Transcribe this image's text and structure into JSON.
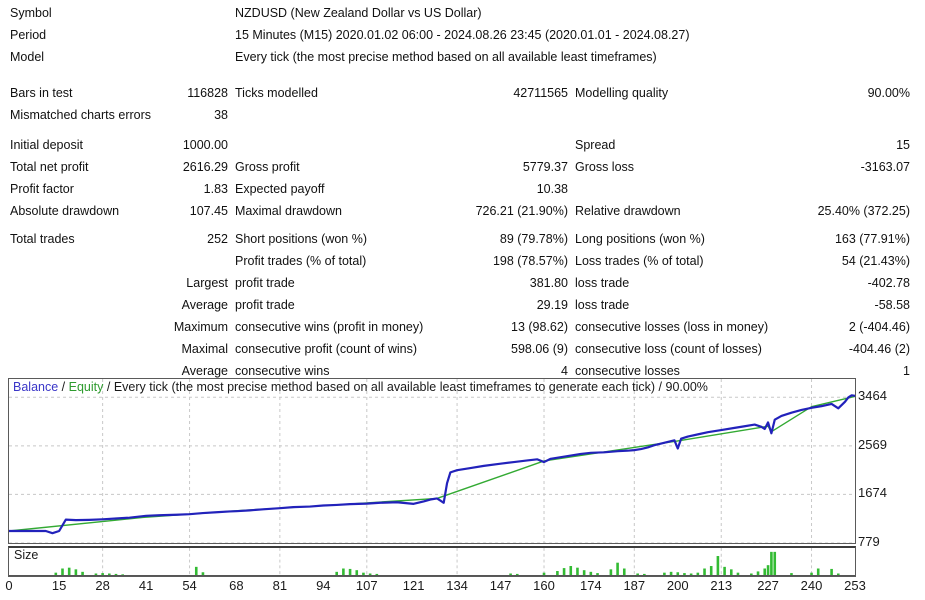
{
  "header": {
    "rows": [
      {
        "label": "Symbol",
        "value": "NZDUSD (New Zealand Dollar vs US Dollar)"
      },
      {
        "label": "Period",
        "value": "15 Minutes (M15) 2020.01.02 06:00 - 2024.08.26 23:45 (2020.01.01 - 2024.08.27)"
      },
      {
        "label": "Model",
        "value": "Every tick (the most precise method based on all available least timeframes)"
      }
    ]
  },
  "stats": {
    "groups": [
      {
        "rows": [
          {
            "c1_label": "Bars in test",
            "c1_value": "116828",
            "c2_label": "Ticks modelled",
            "c2_value": "42711565",
            "c3_label": "Modelling quality",
            "c3_value": "90.00%"
          },
          {
            "c1_label": "Mismatched charts errors",
            "c1_value": "38",
            "c2_label": "",
            "c2_value": "",
            "c3_label": "",
            "c3_value": ""
          }
        ]
      },
      {
        "rows": [
          {
            "c1_label": "Initial deposit",
            "c1_value": "1000.00",
            "c2_label": "",
            "c2_value": "",
            "c3_label": "Spread",
            "c3_value": "15"
          },
          {
            "c1_label": "Total net profit",
            "c1_value": "2616.29",
            "c2_label": "Gross profit",
            "c2_value": "5779.37",
            "c3_label": "Gross loss",
            "c3_value": "-3163.07"
          },
          {
            "c1_label": "Profit factor",
            "c1_value": "1.83",
            "c2_label": "Expected payoff",
            "c2_value": "10.38",
            "c3_label": "",
            "c3_value": ""
          },
          {
            "c1_label": "Absolute drawdown",
            "c1_value": "107.45",
            "c2_label": "Maximal drawdown",
            "c2_value": "726.21 (21.90%)",
            "c3_label": "Relative drawdown",
            "c3_value": "25.40% (372.25)"
          }
        ]
      },
      {
        "rows": [
          {
            "c1_label": "Total trades",
            "c1_value": "252",
            "c2_label": "Short positions (won %)",
            "c2_value": "89 (79.78%)",
            "c3_label": "Long positions (won %)",
            "c3_value": "163 (77.91%)"
          },
          {
            "c1_label": "",
            "c1_value": "",
            "c2_label": "Profit trades (% of total)",
            "c2_value": "198 (78.57%)",
            "c3_label": "Loss trades (% of total)",
            "c3_value": "54 (21.43%)"
          },
          {
            "c1_prefix": "Largest",
            "c2_label": "profit trade",
            "c2_value": "381.80",
            "c3_label": "loss trade",
            "c3_value": "-402.78"
          },
          {
            "c1_prefix": "Average",
            "c2_label": "profit trade",
            "c2_value": "29.19",
            "c3_label": "loss trade",
            "c3_value": "-58.58"
          },
          {
            "c1_prefix": "Maximum",
            "c2_label": "consecutive wins (profit in money)",
            "c2_value": "13 (98.62)",
            "c3_label": "consecutive losses (loss in money)",
            "c3_value": "2 (-404.46)"
          },
          {
            "c1_prefix": "Maximal",
            "c2_label": "consecutive profit (count of wins)",
            "c2_value": "598.06 (9)",
            "c3_label": "consecutive loss (count of losses)",
            "c3_value": "-404.46 (2)"
          },
          {
            "c1_prefix": "Average",
            "c2_label": "consecutive wins",
            "c2_value": "4",
            "c3_label": "consecutive losses",
            "c3_value": "1"
          }
        ]
      }
    ]
  },
  "chart": {
    "legend": {
      "balance": "Balance",
      "equity": "Equity",
      "separator": "/",
      "description": "Every tick (the most precise method based on all available least timeframes to generate each tick) / 90.00%"
    },
    "size_panel_label": "Size",
    "colors": {
      "balance_line": "#2222bb",
      "equity_line": "#33aa33",
      "size_bar": "#33bb33",
      "grid": "#c8c8c8",
      "border": "#5a5a5a"
    }
  },
  "chart_data": {
    "type": "line",
    "title": "Balance / Equity / Every tick (the most precise method based on all available least timeframes to generate each tick) / 90.00%",
    "xlabel": "",
    "ylabel": "",
    "grid": true,
    "legend_position": "top-left",
    "xlim": [
      0,
      253
    ],
    "ylim": [
      779,
      3800
    ],
    "yticks": [
      779,
      1674,
      2569,
      3464
    ],
    "xticks": [
      0,
      15,
      28,
      41,
      54,
      68,
      81,
      94,
      107,
      121,
      134,
      147,
      160,
      174,
      187,
      200,
      213,
      227,
      240,
      253
    ],
    "series": [
      {
        "name": "Balance",
        "color": "#2222bb",
        "x": [
          0,
          4,
          8,
          11,
          13,
          15,
          17,
          20,
          24,
          28,
          32,
          36,
          41,
          45,
          50,
          54,
          58,
          62,
          66,
          68,
          72,
          76,
          81,
          85,
          90,
          94,
          98,
          102,
          107,
          111,
          116,
          121,
          124,
          126,
          128,
          129,
          130,
          131,
          132,
          134,
          138,
          142,
          147,
          151,
          155,
          158,
          160,
          162,
          165,
          168,
          171,
          174,
          178,
          182,
          185,
          187,
          189,
          191,
          193,
          195,
          197,
          199,
          200,
          201,
          203,
          206,
          209,
          213,
          217,
          220,
          223,
          225,
          226,
          227,
          228,
          229,
          231,
          234,
          237,
          240,
          243,
          246,
          248,
          250,
          251,
          252,
          253
        ],
        "y": [
          1000,
          1000,
          1000,
          1000,
          960,
          1000,
          1210,
          1200,
          1205,
          1215,
          1230,
          1245,
          1280,
          1290,
          1300,
          1310,
          1330,
          1345,
          1360,
          1365,
          1380,
          1400,
          1420,
          1440,
          1450,
          1470,
          1480,
          1495,
          1505,
          1520,
          1530,
          1500,
          1545,
          1580,
          1600,
          1560,
          1520,
          1880,
          2080,
          2120,
          2160,
          2200,
          2240,
          2270,
          2300,
          2320,
          2270,
          2330,
          2360,
          2390,
          2420,
          2440,
          2450,
          2470,
          2480,
          2490,
          2510,
          2540,
          2580,
          2610,
          2640,
          2670,
          2520,
          2700,
          2740,
          2780,
          2820,
          2860,
          2900,
          2930,
          2960,
          2920,
          2880,
          3000,
          2800,
          3050,
          3120,
          3180,
          3230,
          3270,
          3300,
          3340,
          3260,
          3380,
          3460,
          3500,
          3490
        ]
      },
      {
        "name": "Equity",
        "color": "#33aa33",
        "x": [
          0,
          40,
          70,
          100,
          128,
          160,
          200,
          227,
          228,
          240,
          253
        ],
        "y": [
          1000,
          1250,
          1380,
          1490,
          1600,
          2290,
          2660,
          2930,
          2830,
          3290,
          3480
        ]
      }
    ],
    "size_subplot": {
      "type": "bar",
      "label": "Size",
      "color": "#33bb33",
      "x": [
        14,
        16,
        18,
        20,
        22,
        26,
        28,
        30,
        32,
        34,
        56,
        58,
        98,
        100,
        102,
        104,
        106,
        108,
        110,
        150,
        152,
        160,
        164,
        166,
        168,
        170,
        172,
        174,
        176,
        180,
        182,
        184,
        188,
        190,
        196,
        198,
        200,
        202,
        204,
        206,
        208,
        210,
        212,
        214,
        216,
        218,
        222,
        224,
        226,
        227,
        228,
        229,
        234,
        240,
        242,
        246,
        248
      ],
      "values": [
        0.4,
        0.9,
        1.0,
        0.8,
        0.5,
        0.3,
        0.35,
        0.3,
        0.25,
        0.2,
        1.1,
        0.45,
        0.5,
        0.9,
        0.85,
        0.7,
        0.4,
        0.3,
        0.25,
        0.3,
        0.25,
        0.4,
        0.6,
        0.95,
        1.2,
        1.0,
        0.7,
        0.5,
        0.35,
        0.8,
        1.6,
        0.9,
        0.3,
        0.25,
        0.4,
        0.5,
        0.45,
        0.35,
        0.3,
        0.4,
        0.9,
        1.2,
        2.4,
        1.1,
        0.8,
        0.4,
        0.3,
        0.55,
        0.9,
        1.3,
        2.9,
        2.9,
        0.35,
        0.4,
        0.9,
        0.85,
        0.3
      ]
    }
  }
}
